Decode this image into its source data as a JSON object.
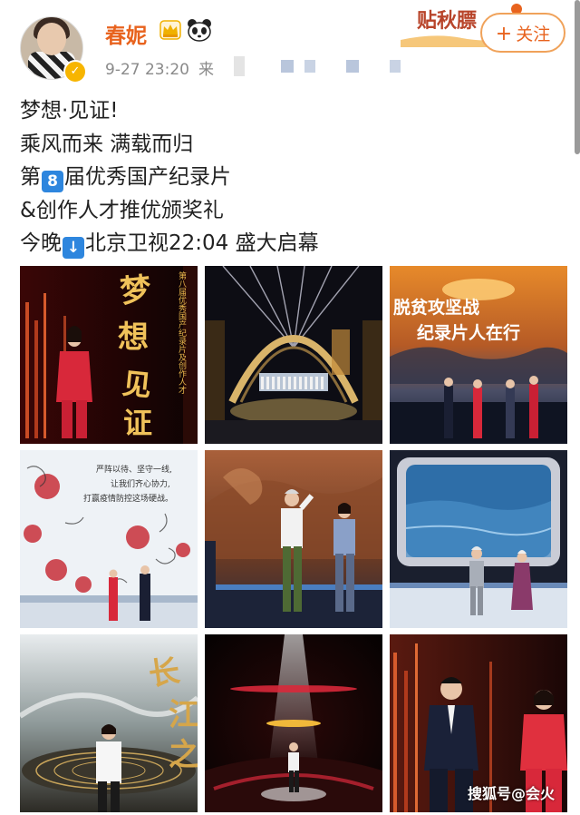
{
  "post": {
    "username": "春妮",
    "timestamp": "9-27 23:20",
    "source_label": "来",
    "follow_label": "关注",
    "autumn_badge": "贴秋膘"
  },
  "content": {
    "line1": "梦想·见证!",
    "line2": "乘风而来 满载而归",
    "line3_prefix": "第",
    "line3_emoji": "8",
    "line3_suffix": "届优秀国产纪录片",
    "line4": "&创作人才推优颁奖礼",
    "line5_prefix": "今晚",
    "line5_emoji": "↓",
    "line5_suffix": "北京卫视22:04 盛大启幕"
  },
  "images": {
    "img1_title": "梦想·见证",
    "img1_side": "第八届优秀国产纪录片及创作人才",
    "img3_caption_a": "脱贫攻坚战",
    "img3_caption_b": "纪录片人在行",
    "img4_text_a": "严阵以待、坚守一线,",
    "img4_text_b": "让我们齐心协力,",
    "img4_text_c": "打赢疫情防控这场硬战。",
    "img7_title": "长江之歌"
  },
  "watermark": "搜狐号@会火",
  "icons": {
    "verified": "verified-badge-icon",
    "crown": "crown-icon",
    "panda": "panda-icon",
    "plus": "plus-icon",
    "emoji_8": "keycap-8-icon",
    "emoji_down": "down-arrow-icon"
  },
  "colors": {
    "username": "#e8631e",
    "follow_border": "#f0a25a",
    "verified": "#f7b500",
    "emoji": "#2e86de"
  }
}
